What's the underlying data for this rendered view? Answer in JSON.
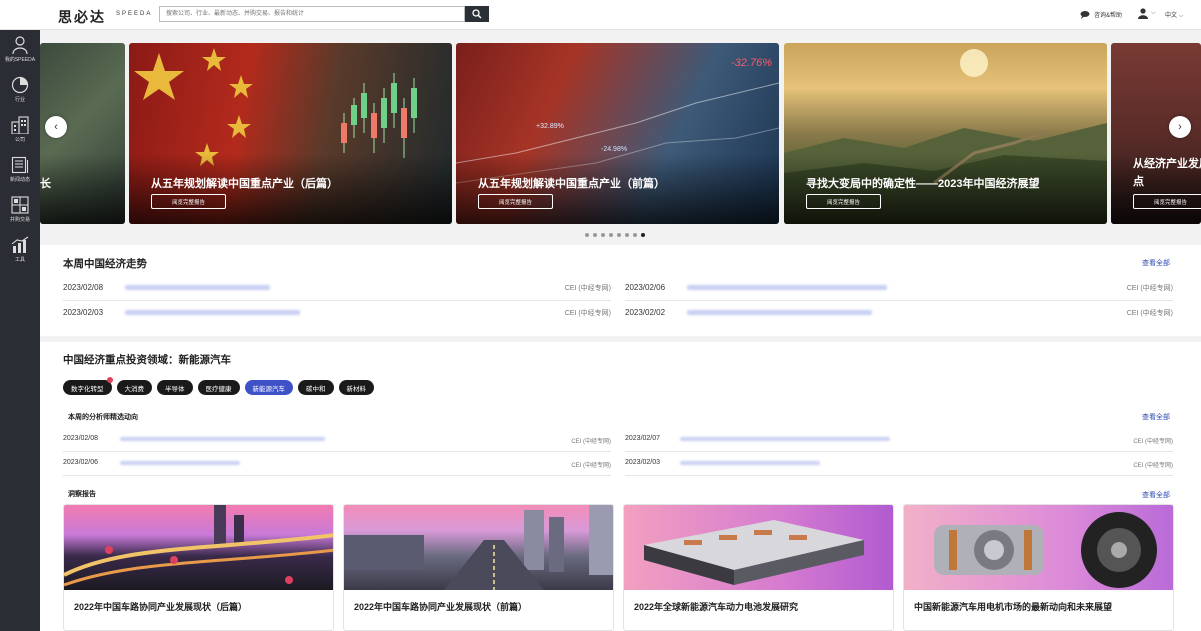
{
  "header": {
    "logo": "思必达",
    "logo_sub": "SPEEDA",
    "search_placeholder": "搜索公司、行业、最新动态、并购交易、报告和统计",
    "help_label": "咨询&帮助",
    "lang_label": "中文"
  },
  "sidebar": {
    "items": [
      {
        "label": "我的SPEEDA",
        "icon": "user-icon"
      },
      {
        "label": "行业",
        "icon": "pie-chart-icon"
      },
      {
        "label": "公司",
        "icon": "building-icon"
      },
      {
        "label": "新闻动态",
        "icon": "newspaper-icon"
      },
      {
        "label": "并购交易",
        "icon": "deal-icon"
      },
      {
        "label": "工具",
        "icon": "tools-chart-icon"
      }
    ]
  },
  "hero": {
    "cards": [
      {
        "title": "长",
        "button": ""
      },
      {
        "title": "从五年规划解读中国重点产业（后篇）",
        "button": "阅览完整报告"
      },
      {
        "title": "从五年规划解读中国重点产业（前篇）",
        "button": "阅览完整报告"
      },
      {
        "title": "寻找大变局中的确定性——2023年中国经济展望",
        "button": "阅览完整报告"
      },
      {
        "title": "从经济产业发展看",
        "title2": "点",
        "button": "阅览完整报告"
      }
    ],
    "overlay_text": [
      "-32.76%",
      "+32.89%",
      "-24.98%"
    ],
    "dot_count": 8,
    "active_dot": 8
  },
  "weekly": {
    "title": "本周中国经济走势",
    "see_all": "查看全部",
    "rows": [
      {
        "date": "2023/02/08",
        "source": "CEI (中经专网)"
      },
      {
        "date": "2023/02/06",
        "source": "CEI (中经专网)"
      },
      {
        "date": "2023/02/03",
        "source": "CEI (中经专网)"
      },
      {
        "date": "2023/02/02",
        "source": "CEI (中经专网)"
      }
    ]
  },
  "focus": {
    "title": "中国经济重点投资领域：新能源汽车",
    "tags": [
      "数字化转型",
      "大消费",
      "半导体",
      "医疗健康",
      "新能源汽车",
      "碳中和",
      "新材料"
    ],
    "active_tag": "新能源汽车",
    "analysts": {
      "title": "本周的分析师精选动向",
      "see_all": "查看全部",
      "rows": [
        {
          "date": "2023/02/08",
          "source": "CEI (中经专网)"
        },
        {
          "date": "2023/02/07",
          "source": "CEI (中经专网)"
        },
        {
          "date": "2023/02/06",
          "source": "CEI (中经专网)"
        },
        {
          "date": "2023/02/03",
          "source": "CEI (中经专网)"
        }
      ]
    },
    "reports": {
      "title": "洞察报告",
      "see_all": "查看全部",
      "items": [
        "2022年中国车路协同产业发展现状（后篇）",
        "2022年中国车路协同产业发展现状（前篇）",
        "2022年全球新能源汽车动力电池发展研究",
        "中国新能源汽车用电机市场的最新动向和未来展望"
      ]
    }
  }
}
